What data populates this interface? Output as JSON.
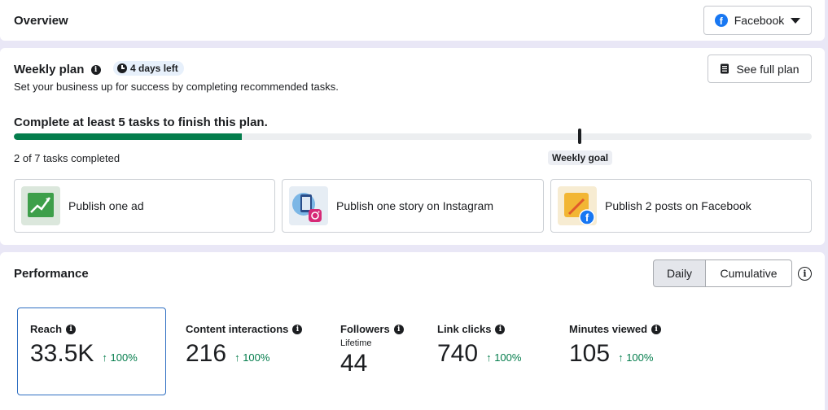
{
  "overview": {
    "title": "Overview",
    "platform_select": "Facebook"
  },
  "weekly_plan": {
    "title": "Weekly plan",
    "badge": "4 days left",
    "subtitle": "Set your business up for success by completing recommended tasks.",
    "see_full_plan": "See full plan",
    "goal_heading": "Complete at least 5 tasks to finish this plan.",
    "tasks_completed": "2 of 7 tasks completed",
    "progress_fraction": 0.2857,
    "weekly_goal_label": "Weekly goal",
    "tasks": [
      {
        "label": "Publish one ad",
        "icon": "chart-growth-icon"
      },
      {
        "label": "Publish one story on Instagram",
        "icon": "instagram-story-icon"
      },
      {
        "label": "Publish 2 posts on Facebook",
        "icon": "facebook-post-icon"
      }
    ]
  },
  "performance": {
    "title": "Performance",
    "toggle": {
      "daily": "Daily",
      "cumulative": "Cumulative",
      "selected": "Daily"
    },
    "metrics": [
      {
        "label": "Reach",
        "value": "33.5K",
        "change": "100%"
      },
      {
        "label": "Content interactions",
        "value": "216",
        "change": "100%"
      },
      {
        "label": "Followers",
        "sublabel": "Lifetime",
        "value": "44"
      },
      {
        "label": "Link clicks",
        "value": "740",
        "change": "100%"
      },
      {
        "label": "Minutes viewed",
        "value": "105",
        "change": "100%"
      }
    ]
  },
  "colors": {
    "accent_green": "#047d4c",
    "facebook_blue": "#1877f2",
    "selected_outline": "#2f6fc2"
  }
}
